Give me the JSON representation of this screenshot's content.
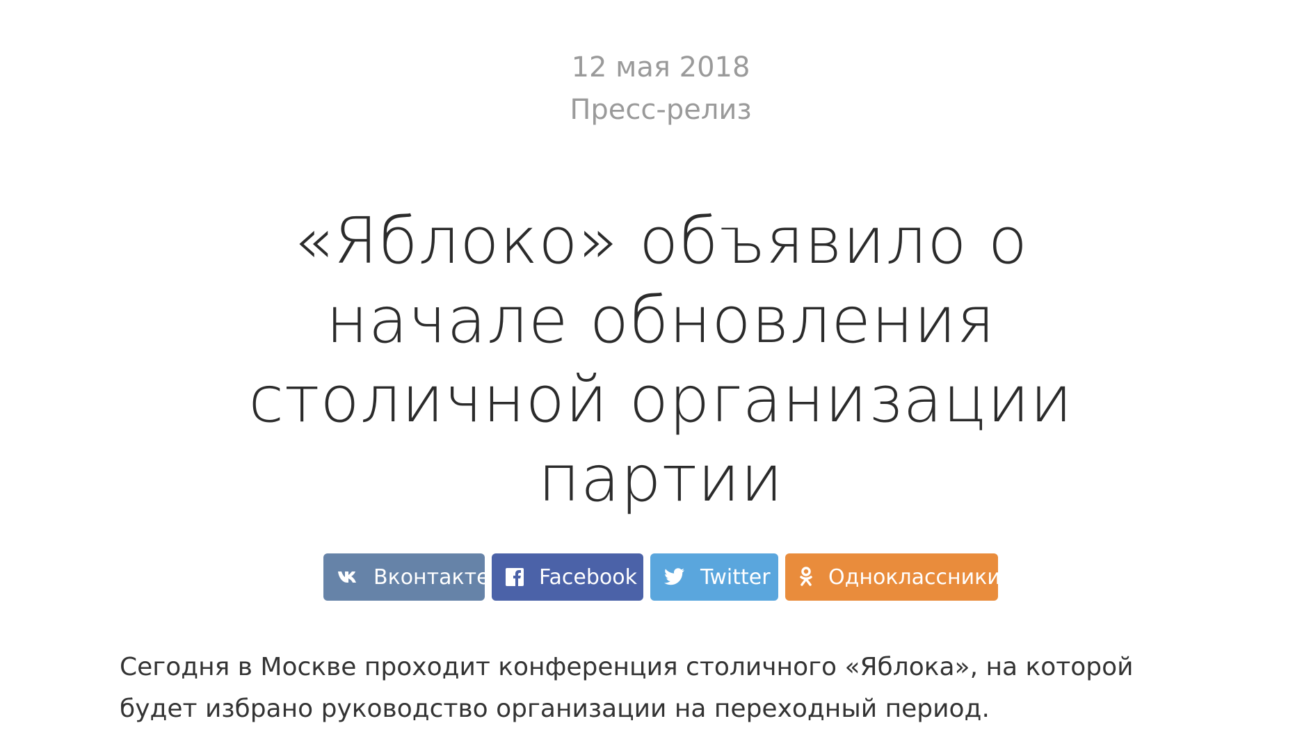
{
  "article": {
    "date": "12 мая 2018",
    "category": "Пресс-релиз",
    "title": "«Яблоко» объявило о началe обновления столичной организации партии",
    "lead": "Сегодня в Москве проходит конференция столичного «Яблока», на которой будет избрано руководство организации на переходный период."
  },
  "share": {
    "buttons": [
      {
        "label": "Вконтакте",
        "icon": "vk-icon",
        "color": "#6683a8"
      },
      {
        "label": "Facebook",
        "icon": "facebook-icon",
        "color": "#4b62a8"
      },
      {
        "label": "Twitter",
        "icon": "twitter-icon",
        "color": "#5aa6dd"
      },
      {
        "label": "Одноклассники",
        "icon": "odnoklassniki-icon",
        "color": "#e98c3c"
      }
    ]
  }
}
